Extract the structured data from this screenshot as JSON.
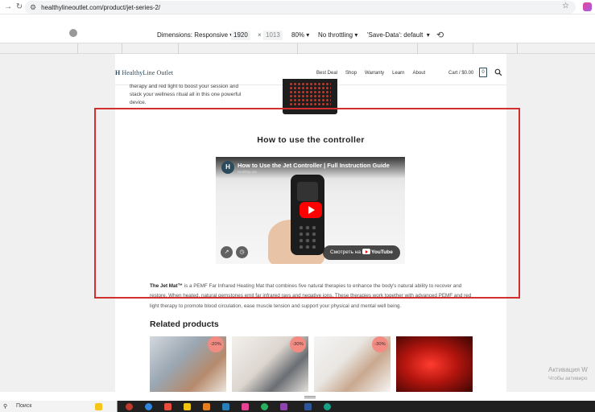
{
  "browser": {
    "url": "healthylineoutlet.com/product/jet-series-2/"
  },
  "devtools": {
    "dimensions_label": "Dimensions: Responsive",
    "width": "1920",
    "separator": "×",
    "height": "1013",
    "zoom": "80%",
    "throttling": "No throttling",
    "save_data": "'Save-Data': default"
  },
  "site": {
    "logo_text": "HealthyLine Outlet",
    "nav": [
      "Best Deal",
      "Shop",
      "Warranty",
      "Learn",
      "About"
    ],
    "cart_label": "Cart / $0.00",
    "cart_count": "0"
  },
  "content": {
    "intro_text": "therapy and red light to boost your session and stack your wellness ritual all in this one powerful device.",
    "section_title": "How to use the controller",
    "video": {
      "title": "How to Use the Jet Controller | Full Instruction Guide",
      "channel": "HealthyLine",
      "channel_initial": "H",
      "watch_label": "Смотреть на",
      "watch_brand": "YouTube"
    },
    "description_bold": "The Jet Mat™",
    "description_text": " is a  PEMF Far Infrared Heating Mat that combines five natural therapies to enhance the body's natural ability to recover and restore. When heated, natural gemstones emit far infrared rays and negative ions. These therapies work together with advanced PEMF and red light therapy to promote blood circulation, ease muscle tension and support your physical and mental well being.",
    "related_title": "Related products",
    "related_products": [
      {
        "badge": "-20%"
      },
      {
        "badge": "-30%"
      },
      {
        "badge": "-30%"
      },
      {
        "badge": ""
      }
    ]
  },
  "os": {
    "activation_title": "Активация W",
    "activation_sub": "Чтобы активиро",
    "taskbar_search": "Поиск"
  },
  "colors": {
    "highlight": "#d32f2f",
    "brand": "#2b4a5c",
    "badge": "#f28b82",
    "youtube_red": "#ff0000"
  }
}
